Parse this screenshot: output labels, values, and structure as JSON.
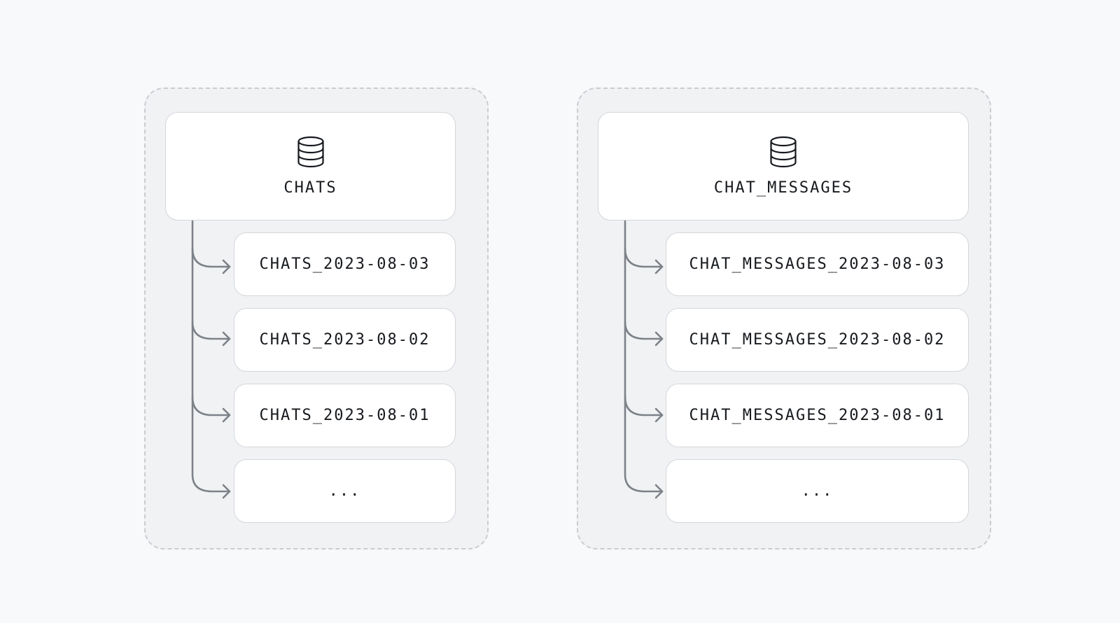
{
  "groups": [
    {
      "title": "CHATS",
      "icon": "database-icon",
      "children": [
        "CHATS_2023-08-03",
        "CHATS_2023-08-02",
        "CHATS_2023-08-01",
        "..."
      ]
    },
    {
      "title": "CHAT_MESSAGES",
      "icon": "database-icon",
      "children": [
        "CHAT_MESSAGES_2023-08-03",
        "CHAT_MESSAGES_2023-08-02",
        "CHAT_MESSAGES_2023-08-01",
        "..."
      ]
    }
  ],
  "colors": {
    "background": "#f8f9fa",
    "group_fill": "#f1f2f4",
    "group_border": "#c9cdd2",
    "card_fill": "#ffffff",
    "card_border": "#d3d6da",
    "connector": "#7c8288",
    "text": "#16191d"
  }
}
